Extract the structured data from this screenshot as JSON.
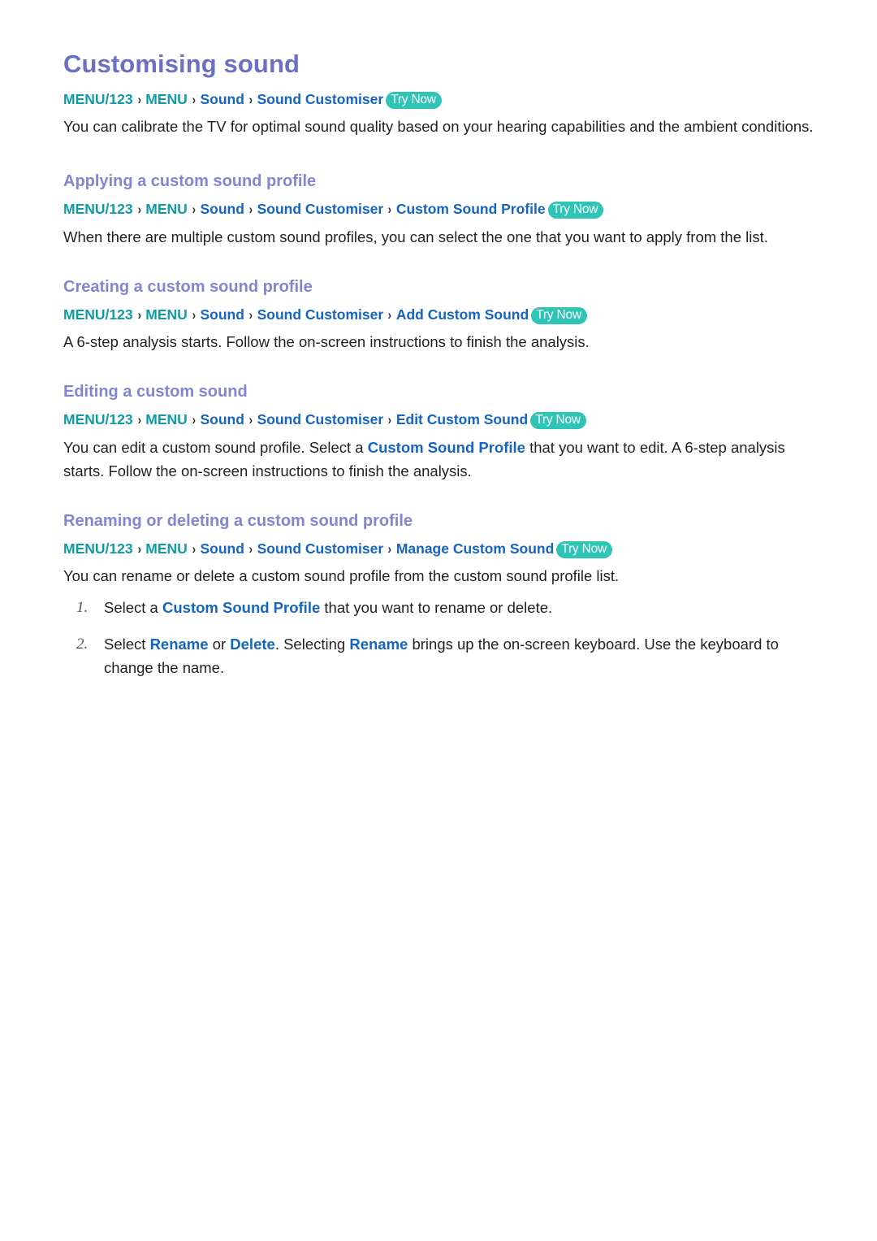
{
  "document": {
    "title": "Customising sound",
    "try_now_label": "Try Now",
    "separator": "›",
    "colors": {
      "title": "#6b70c4",
      "heading": "#8186d0",
      "menu_crumb": "#0e9aa7",
      "item_crumb": "#1565c0",
      "badge": "#2ec4b6",
      "body": "#231f20"
    },
    "intro": {
      "breadcrumb": {
        "menu_parts": [
          "MENU/123",
          "MENU"
        ],
        "items": [
          "Sound",
          "Sound Customiser"
        ]
      },
      "paragraph": "You can calibrate the TV for optimal sound quality based on your hearing capabilities and the ambient conditions."
    },
    "sections": [
      {
        "heading": "Applying a custom sound profile",
        "breadcrumb": {
          "menu_parts": [
            "MENU/123",
            "MENU"
          ],
          "items": [
            "Sound",
            "Sound Customiser",
            "Custom Sound Profile"
          ]
        },
        "paragraph": "When there are multiple custom sound profiles, you can select the one that you want to apply from the list."
      },
      {
        "heading": "Creating a custom sound profile",
        "breadcrumb": {
          "menu_parts": [
            "MENU/123",
            "MENU"
          ],
          "items": [
            "Sound",
            "Sound Customiser",
            "Add Custom Sound"
          ]
        },
        "paragraph": "A 6-step analysis starts. Follow the on-screen instructions to finish the analysis."
      },
      {
        "heading": "Editing a custom sound",
        "breadcrumb": {
          "menu_parts": [
            "MENU/123",
            "MENU"
          ],
          "items": [
            "Sound",
            "Sound Customiser",
            "Edit Custom Sound"
          ]
        },
        "paragraph_part1": "You can edit a custom sound profile. Select a ",
        "paragraph_highlight": "Custom Sound Profile",
        "paragraph_part2": " that you want to edit. A 6-step analysis starts. Follow the on-screen instructions to finish the analysis."
      },
      {
        "heading": "Renaming or deleting a custom sound profile",
        "breadcrumb": {
          "menu_parts": [
            "MENU/123",
            "MENU"
          ],
          "items": [
            "Sound",
            "Sound Customiser",
            "Manage Custom Sound"
          ]
        },
        "paragraph": "You can rename or delete a custom sound profile from the custom sound profile list.",
        "steps": [
          {
            "marker": "1.",
            "part1": "Select a ",
            "hl1": "Custom Sound Profile",
            "part2": " that you want to rename or delete."
          },
          {
            "marker": "2.",
            "part1": "Select ",
            "hl1": "Rename",
            "part2": " or ",
            "hl2": "Delete",
            "part3": ". Selecting ",
            "hl3": "Rename",
            "part4": " brings up the on-screen keyboard. Use the keyboard to change the name."
          }
        ]
      }
    ]
  }
}
